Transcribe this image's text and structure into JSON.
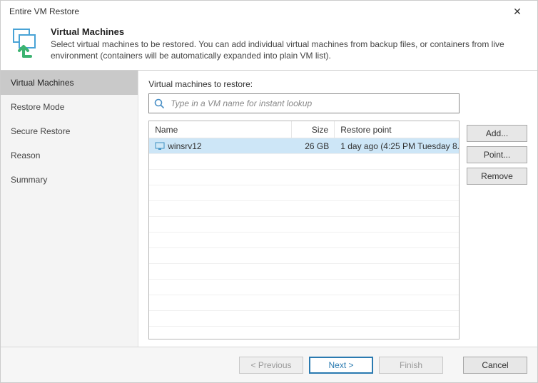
{
  "window": {
    "title": "Entire VM Restore"
  },
  "header": {
    "title": "Virtual Machines",
    "description": "Select virtual machines to be restored. You can add individual virtual machines from backup files, or containers from live environment (containers will be automatically expanded into plain VM list)."
  },
  "sidebar": {
    "items": [
      {
        "label": "Virtual Machines",
        "active": true
      },
      {
        "label": "Restore Mode",
        "active": false
      },
      {
        "label": "Secure Restore",
        "active": false
      },
      {
        "label": "Reason",
        "active": false
      },
      {
        "label": "Summary",
        "active": false
      }
    ]
  },
  "main": {
    "list_label": "Virtual machines to restore:",
    "search_placeholder": "Type in a VM name for instant lookup",
    "columns": {
      "name": "Name",
      "size": "Size",
      "restore_point": "Restore point"
    },
    "rows": [
      {
        "name": "winsrv12",
        "size": "26 GB",
        "restore_point": "1 day ago (4:25 PM Tuesday 8...",
        "selected": true
      }
    ]
  },
  "side_buttons": {
    "add": "Add...",
    "point": "Point...",
    "remove": "Remove"
  },
  "footer": {
    "previous": "< Previous",
    "next": "Next >",
    "finish": "Finish",
    "cancel": "Cancel"
  }
}
